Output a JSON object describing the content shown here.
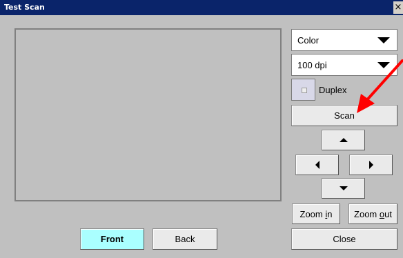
{
  "window": {
    "title": "Test Scan",
    "close_glyph": "×"
  },
  "selects": {
    "color": {
      "value": "Color"
    },
    "resolution": {
      "value": "100 dpi"
    }
  },
  "duplex": {
    "label": "Duplex",
    "checked": false
  },
  "buttons": {
    "scan": "Scan",
    "zoom_in_prefix": "Zoom ",
    "zoom_in_key": "i",
    "zoom_in_suffix": "n",
    "zoom_out_prefix": "Zoom ",
    "zoom_out_key": "o",
    "zoom_out_suffix": "ut",
    "front": "Front",
    "back": "Back",
    "close": "Close"
  },
  "nav_icons": [
    "arrow-up-icon",
    "arrow-left-icon",
    "arrow-right-icon",
    "arrow-down-icon"
  ],
  "colors": {
    "titlebar": "#0a246a",
    "front_active": "#aaffff",
    "annotation_arrow": "#ff0000"
  }
}
